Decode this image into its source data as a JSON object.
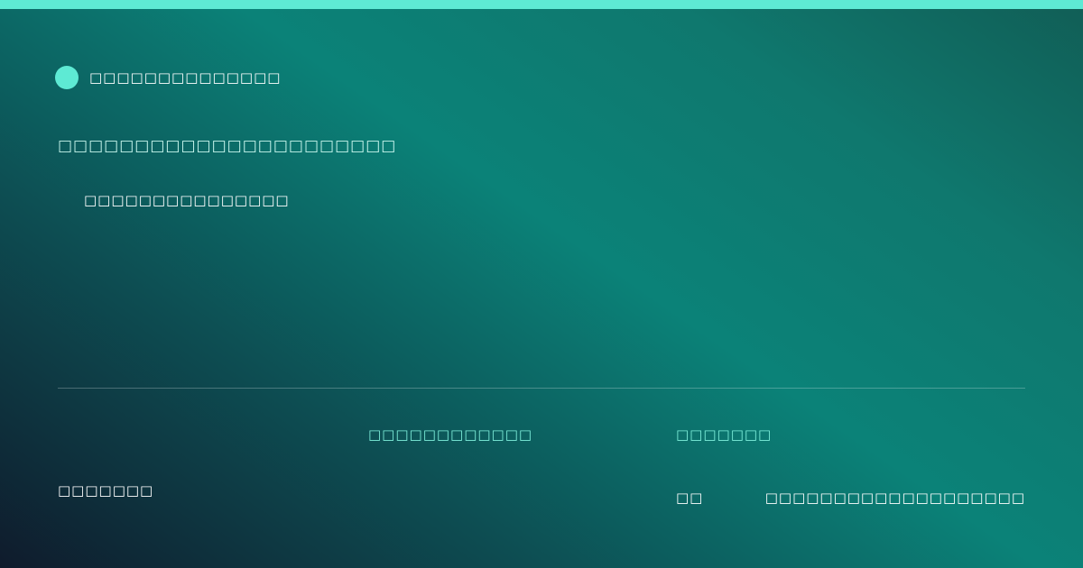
{
  "brand": {
    "name": "□□□□□□□□□□□□□□",
    "accent_color": "#5eead4",
    "icon": "dot-logo-icon"
  },
  "hero": {
    "headline": "□□□□□□□□□□□□□□□□□□□□□□",
    "tagline": "□□□□□□□□□□□□□□□"
  },
  "footer": {
    "left_text": "□□□□□□□",
    "column_a": {
      "label": "□□□□□□□□□□□□"
    },
    "column_b": {
      "label": "□□□□□□□",
      "value": "□□"
    },
    "right_text": "□□□□□□□□□□□□□□□□□□□"
  },
  "colors": {
    "top_bar": "#5eead4",
    "gradient_start": "#0f1b2c",
    "gradient_mid": "#0b8278",
    "gradient_end": "#115e56"
  }
}
